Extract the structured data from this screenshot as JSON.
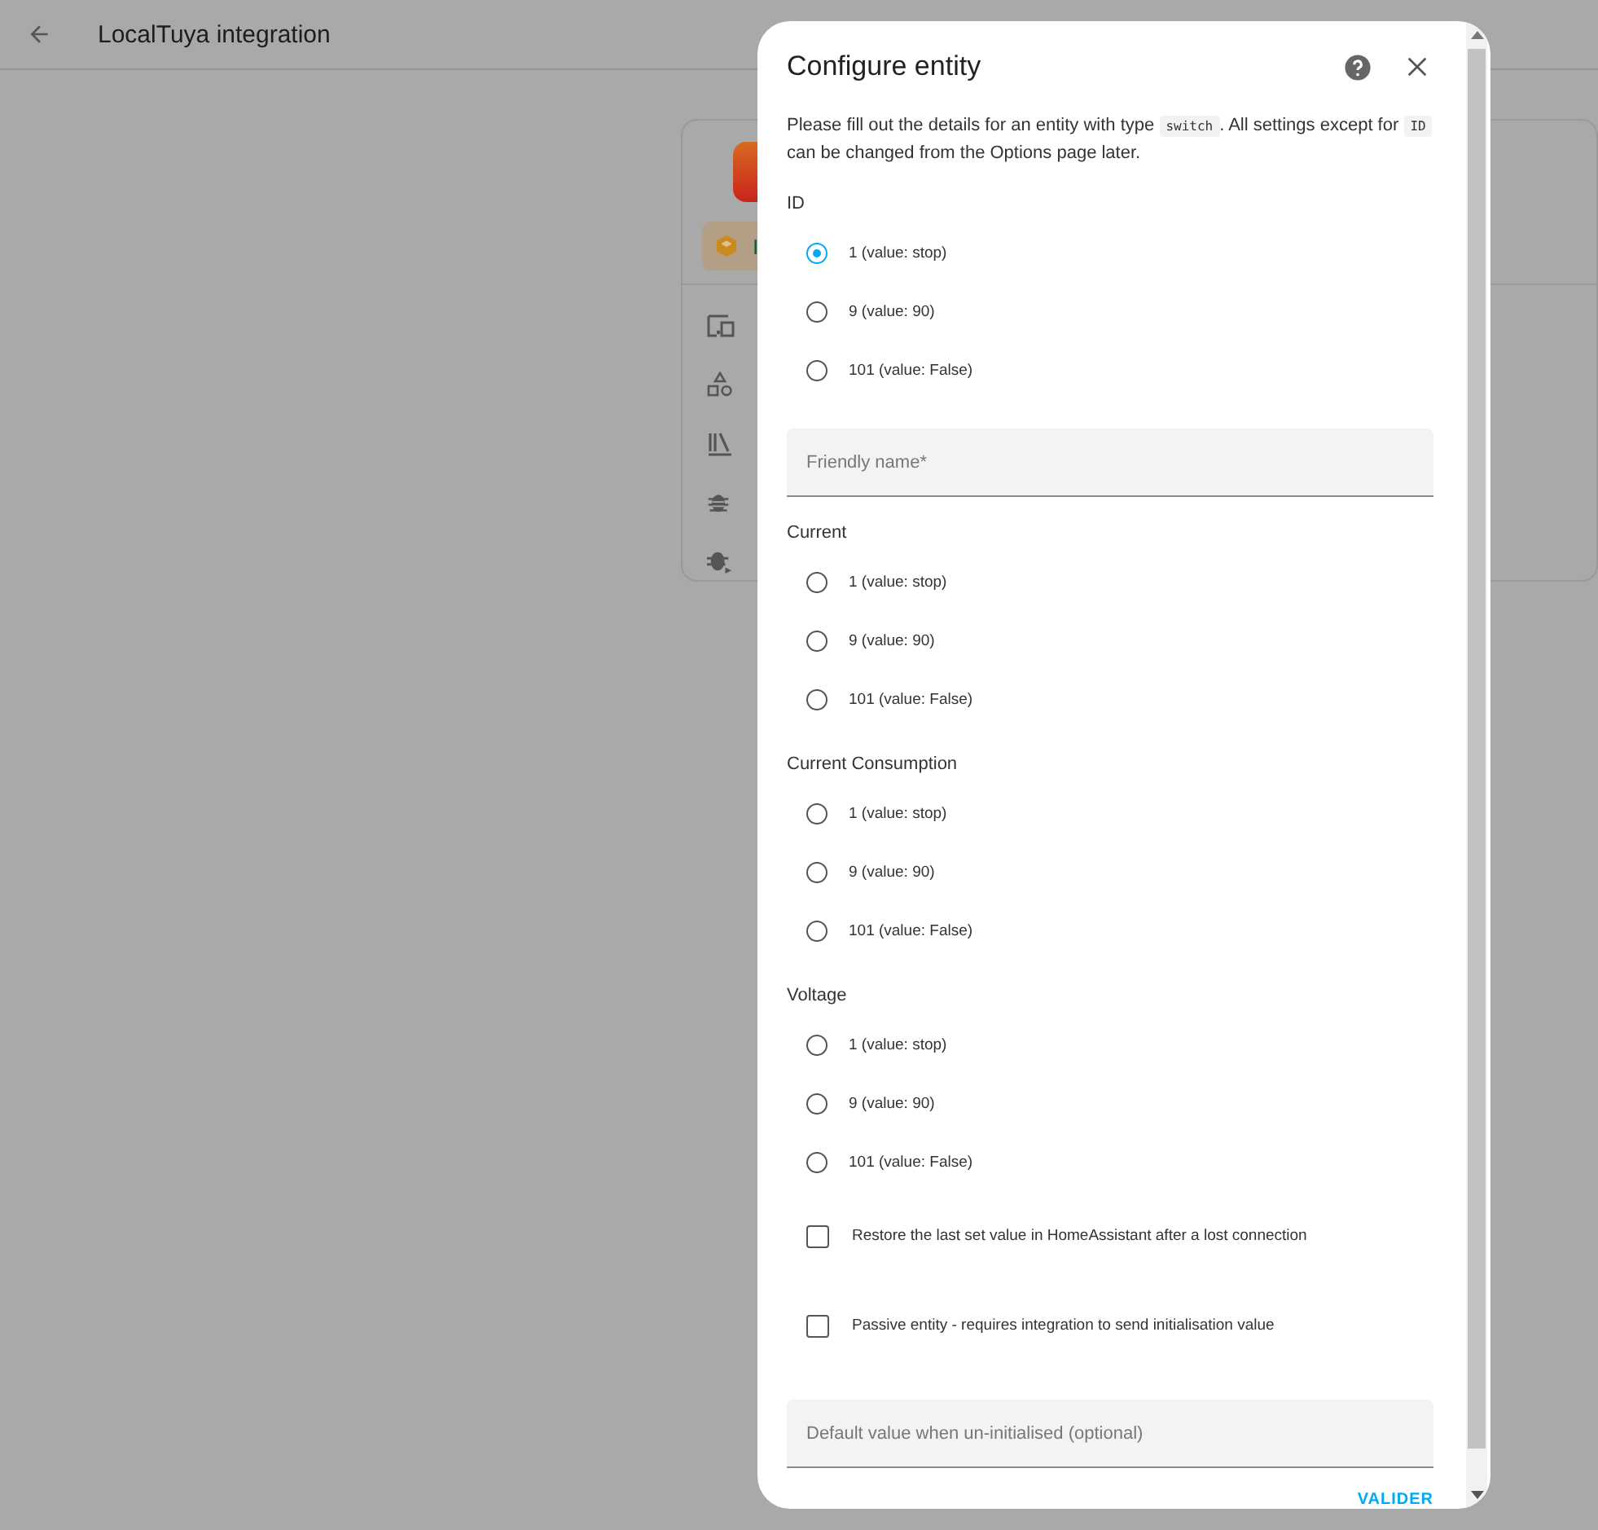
{
  "header": {
    "title": "LocalTuya integration"
  },
  "card": {
    "chip_text": "I"
  },
  "dialog": {
    "title": "Configure entity",
    "description": [
      {
        "kind": "text",
        "text": "Please fill out the details for an entity with type "
      },
      {
        "kind": "code",
        "text": "switch"
      },
      {
        "kind": "text",
        "text": ". All settings except for "
      },
      {
        "kind": "code",
        "text": "ID"
      },
      {
        "kind": "text",
        "text": " can be changed from the Options page later."
      }
    ],
    "fields": [
      {
        "kind": "radio_group",
        "label": "ID",
        "options": [
          {
            "label": "1 (value: stop)",
            "selected": true
          },
          {
            "label": "9 (value: 90)",
            "selected": false
          },
          {
            "label": "101 (value: False)",
            "selected": false
          }
        ]
      },
      {
        "kind": "text_field",
        "placeholder": "Friendly name*"
      },
      {
        "kind": "radio_group",
        "label": "Current",
        "options": [
          {
            "label": "1 (value: stop)",
            "selected": false
          },
          {
            "label": "9 (value: 90)",
            "selected": false
          },
          {
            "label": "101 (value: False)",
            "selected": false
          }
        ]
      },
      {
        "kind": "radio_group",
        "label": "Current Consumption",
        "options": [
          {
            "label": "1 (value: stop)",
            "selected": false
          },
          {
            "label": "9 (value: 90)",
            "selected": false
          },
          {
            "label": "101 (value: False)",
            "selected": false
          }
        ]
      },
      {
        "kind": "radio_group",
        "label": "Voltage",
        "options": [
          {
            "label": "1 (value: stop)",
            "selected": false
          },
          {
            "label": "9 (value: 90)",
            "selected": false
          },
          {
            "label": "101 (value: False)",
            "selected": false
          }
        ]
      },
      {
        "kind": "checkbox",
        "label": "Restore the last set value in HomeAssistant after a lost connection",
        "checked": false
      },
      {
        "kind": "checkbox",
        "label": "Passive entity - requires integration to send initialisation value",
        "checked": false
      },
      {
        "kind": "text_field",
        "placeholder": "Default value when un-initialised (optional)"
      }
    ],
    "submit": "VALIDER"
  }
}
